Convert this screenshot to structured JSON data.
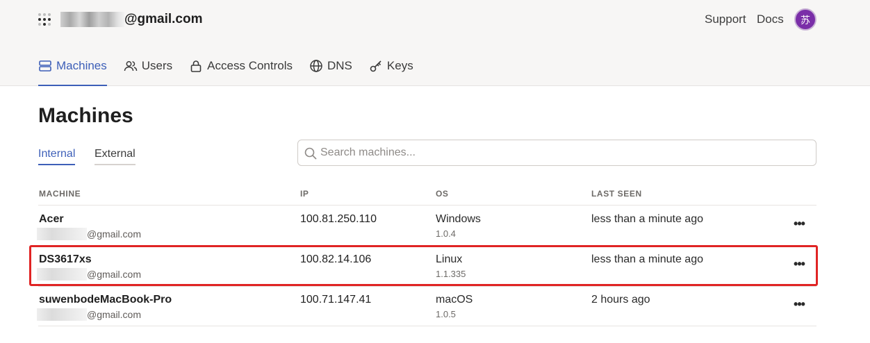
{
  "header": {
    "tailnet_suffix": "@gmail.com",
    "links": {
      "support": "Support",
      "docs": "Docs"
    },
    "avatar_initial": "苏",
    "avatar_color": "#7a2ea8"
  },
  "nav": {
    "items": [
      {
        "label": "Machines",
        "icon": "server-icon",
        "active": true
      },
      {
        "label": "Users",
        "icon": "users-icon",
        "active": false
      },
      {
        "label": "Access Controls",
        "icon": "lock-icon",
        "active": false
      },
      {
        "label": "DNS",
        "icon": "globe-icon",
        "active": false
      },
      {
        "label": "Keys",
        "icon": "key-icon",
        "active": false
      }
    ]
  },
  "page": {
    "title": "Machines",
    "tabs": [
      {
        "label": "Internal",
        "active": true
      },
      {
        "label": "External",
        "active": false
      }
    ],
    "search": {
      "placeholder": "Search machines...",
      "value": ""
    }
  },
  "table": {
    "columns": [
      "MACHINE",
      "IP",
      "OS",
      "LAST SEEN"
    ],
    "rows": [
      {
        "name": "Acer",
        "owner": "@gmail.com",
        "ip": "100.81.250.110",
        "os": "Windows",
        "version": "1.0.4",
        "last_seen": "less than a minute ago",
        "more": "•••"
      },
      {
        "name": "DS3617xs",
        "owner": "@gmail.com",
        "ip": "100.82.14.106",
        "os": "Linux",
        "version": "1.1.335",
        "last_seen": "less than a minute ago",
        "more": "•••",
        "highlighted": true
      },
      {
        "name": "suwenbodeMacBook-Pro",
        "owner": "@gmail.com",
        "ip": "100.71.147.41",
        "os": "macOS",
        "version": "1.0.5",
        "last_seen": "2 hours ago",
        "more": "•••"
      }
    ]
  },
  "colors": {
    "accent": "#3d5fb8",
    "highlight_border": "#e02424",
    "header_bg": "#f7f6f5"
  }
}
